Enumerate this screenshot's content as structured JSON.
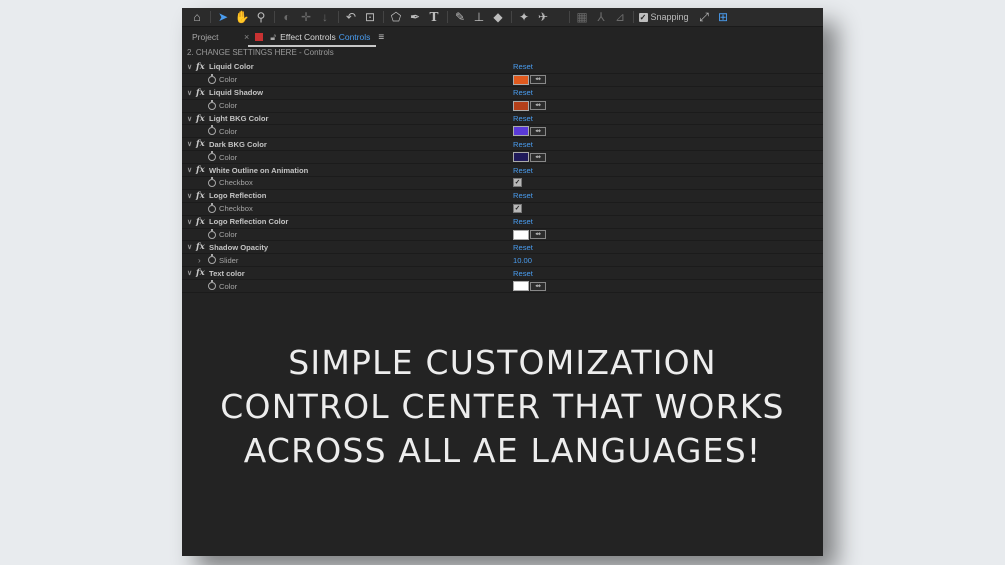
{
  "toolbar": {
    "icons": [
      "home-icon",
      "select-arrow-icon",
      "hand-icon",
      "zoom-icon",
      "orbit-icon",
      "pan-behind-icon",
      "dolly-icon",
      "rotate-icon",
      "anchor-icon",
      "shape-icon",
      "pen-icon",
      "type-icon",
      "brush-icon",
      "clone-stamp-icon",
      "eraser-icon",
      "roto-brush-icon",
      "puppet-pin-icon"
    ],
    "snapping_label": "Snapping"
  },
  "tabs": {
    "project_label": "Project",
    "close_glyph": "×",
    "effect_controls_label": "Effect Controls",
    "layer_name": "Controls",
    "menu_glyph": "≡"
  },
  "layer_title": "2. CHANGE SETTINGS HERE - Controls",
  "effects": [
    {
      "name": "Liquid Color",
      "reset": "Reset",
      "prop": "Color",
      "type": "color",
      "color": "#e05a1e"
    },
    {
      "name": "Liquid Shadow",
      "reset": "Reset",
      "prop": "Color",
      "type": "color",
      "color": "#b4401a"
    },
    {
      "name": "Light BKG Color",
      "reset": "Reset",
      "prop": "Color",
      "type": "color",
      "color": "#5a3ad8"
    },
    {
      "name": "Dark BKG Color",
      "reset": "Reset",
      "prop": "Color",
      "type": "color",
      "color": "#201a5a"
    },
    {
      "name": "White Outline on Animation",
      "reset": "Reset",
      "prop": "Checkbox",
      "type": "checkbox",
      "checked": true
    },
    {
      "name": "Logo Reflection",
      "reset": "Reset",
      "prop": "Checkbox",
      "type": "checkbox",
      "checked": true
    },
    {
      "name": "Logo Reflection Color",
      "reset": "Reset",
      "prop": "Color",
      "type": "color",
      "color": "#ffffff"
    },
    {
      "name": "Shadow Opacity",
      "reset": "Reset",
      "prop": "Slider",
      "type": "slider",
      "value": "10.00"
    },
    {
      "name": "Text color",
      "reset": "Reset",
      "prop": "Color",
      "type": "color",
      "color": "#ffffff"
    }
  ],
  "overlay": {
    "line1": "SIMPLE CUSTOMIZATION",
    "line2": "CONTROL CENTER THAT WORKS",
    "line3": "ACROSS ALL AE LANGUAGES!"
  },
  "colors": {
    "accent": "#4a9df0",
    "panel_bg": "#232323",
    "page_bg": "#e8ebee"
  }
}
